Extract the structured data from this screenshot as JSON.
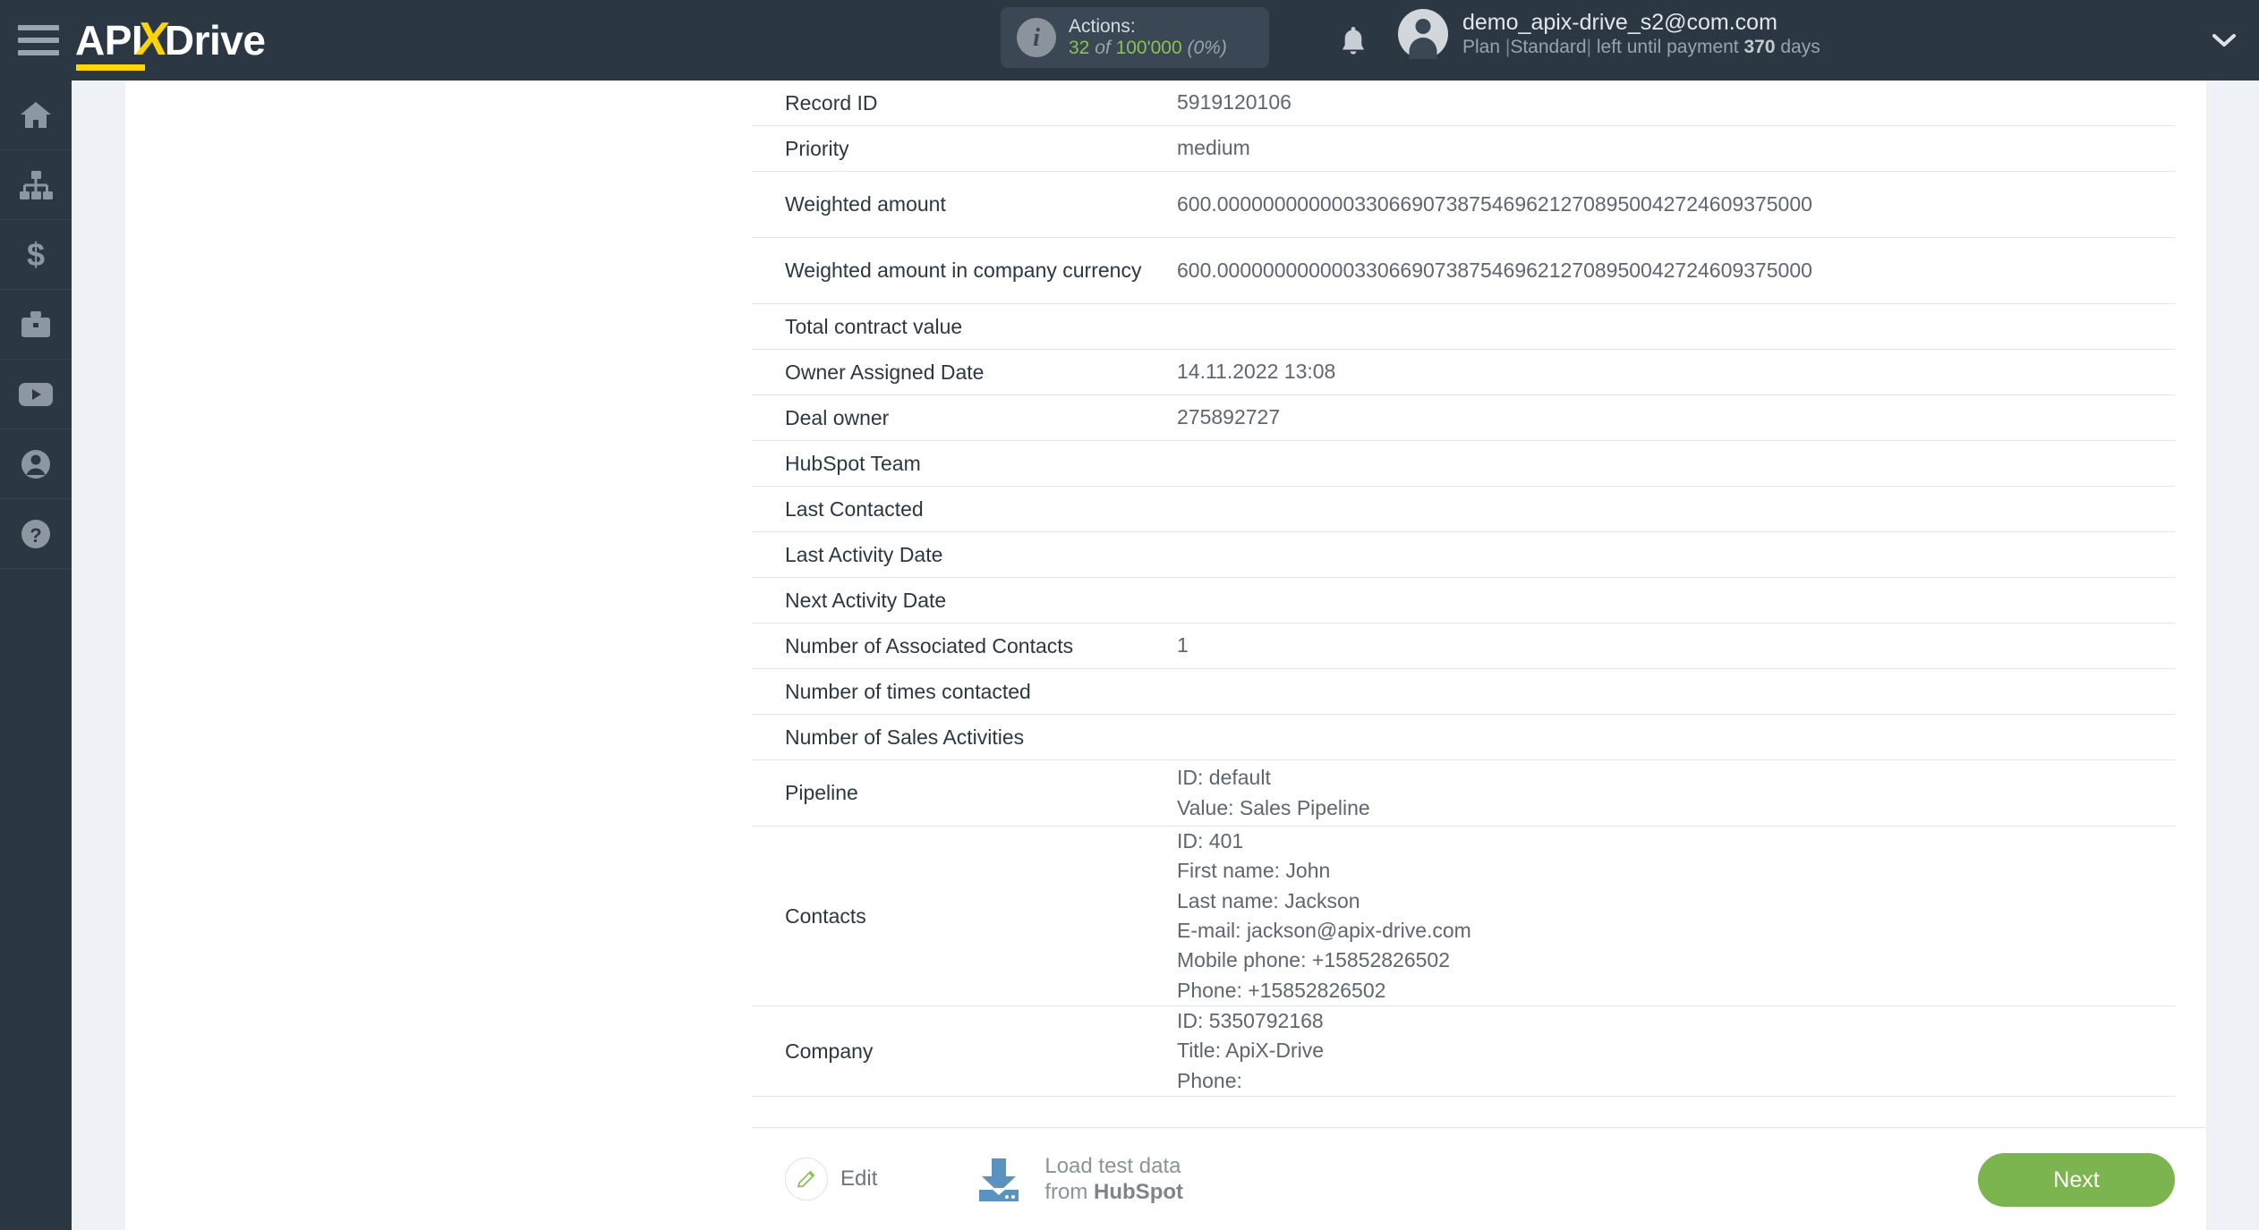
{
  "topbar": {
    "menu_icon": "hamburger-icon",
    "logo": {
      "part1": "API",
      "part2": "X",
      "part3": "Drive"
    },
    "actions": {
      "icon": "info-icon",
      "label": "Actions:",
      "used": "32",
      "of": "of",
      "limit": "100'000",
      "percent": "(0%)"
    },
    "bell_icon": "bell-icon",
    "user": {
      "avatar": "user-avatar-icon",
      "email": "demo_apix-drive_s2@com.com",
      "plan_prefix": "Plan ",
      "plan_name": "Standard",
      "plan_suffix": " left until payment ",
      "plan_days": "370",
      "plan_days_unit": " days",
      "sep": "|"
    },
    "chevron_icon": "chevron-down-icon"
  },
  "sidebar": {
    "items": [
      {
        "icon": "home-icon",
        "name": "sidebar-item-home"
      },
      {
        "icon": "connections-icon",
        "name": "sidebar-item-connections"
      },
      {
        "icon": "dollar-icon",
        "name": "sidebar-item-billing"
      },
      {
        "icon": "briefcase-icon",
        "name": "sidebar-item-business"
      },
      {
        "icon": "youtube-icon",
        "name": "sidebar-item-video"
      },
      {
        "icon": "user-icon",
        "name": "sidebar-item-account"
      },
      {
        "icon": "question-icon",
        "name": "sidebar-item-help"
      }
    ]
  },
  "fields": [
    {
      "label": "Record ID",
      "value": "5919120106",
      "tall": false
    },
    {
      "label": "Priority",
      "value": "medium",
      "tall": false
    },
    {
      "label": "Weighted amount",
      "value": "600.0000000000003306690738754696212708950042724609375000",
      "tall": true
    },
    {
      "label": "Weighted amount in company currency",
      "value": "600.0000000000003306690738754696212708950042724609375000",
      "tall": true
    },
    {
      "label": "Total contract value",
      "value": "",
      "tall": false
    },
    {
      "label": "Owner Assigned Date",
      "value": "14.11.2022 13:08",
      "tall": false
    },
    {
      "label": "Deal owner",
      "value": "275892727",
      "tall": false
    },
    {
      "label": "HubSpot Team",
      "value": "",
      "tall": false
    },
    {
      "label": "Last Contacted",
      "value": "",
      "tall": false
    },
    {
      "label": "Last Activity Date",
      "value": "",
      "tall": false
    },
    {
      "label": "Next Activity Date",
      "value": "",
      "tall": false
    },
    {
      "label": "Number of Associated Contacts",
      "value": "1",
      "tall": false
    },
    {
      "label": "Number of times contacted",
      "value": "",
      "tall": false
    },
    {
      "label": "Number of Sales Activities",
      "value": "",
      "tall": false
    },
    {
      "label": "Pipeline",
      "lines": [
        "ID: default",
        "Value: Sales Pipeline"
      ],
      "tall": true
    },
    {
      "label": "Contacts",
      "lines": [
        "ID: 401",
        "First name: John",
        "Last name: Jackson",
        "E-mail: jackson@apix-drive.com",
        "Mobile phone: +15852826502",
        "Phone: +15852826502"
      ],
      "tall": true
    },
    {
      "label": "Company",
      "lines": [
        "ID: 5350792168",
        "Title: ApiX-Drive",
        "Phone:"
      ],
      "tall": true
    }
  ],
  "footer": {
    "edit_icon": "pencil-icon",
    "edit_label": "Edit",
    "download_icon": "download-icon",
    "load_line1": "Load test data",
    "load_line2_prefix": "from ",
    "load_line2_brand": "HubSpot",
    "next_label": "Next"
  },
  "colors": {
    "topbar_bg": "#2b3844",
    "accent_yellow": "#ffd400",
    "accent_green": "#8cc152",
    "next_green": "#7cb550",
    "download_blue": "#5b93c0",
    "page_bg": "#eef2f7"
  }
}
